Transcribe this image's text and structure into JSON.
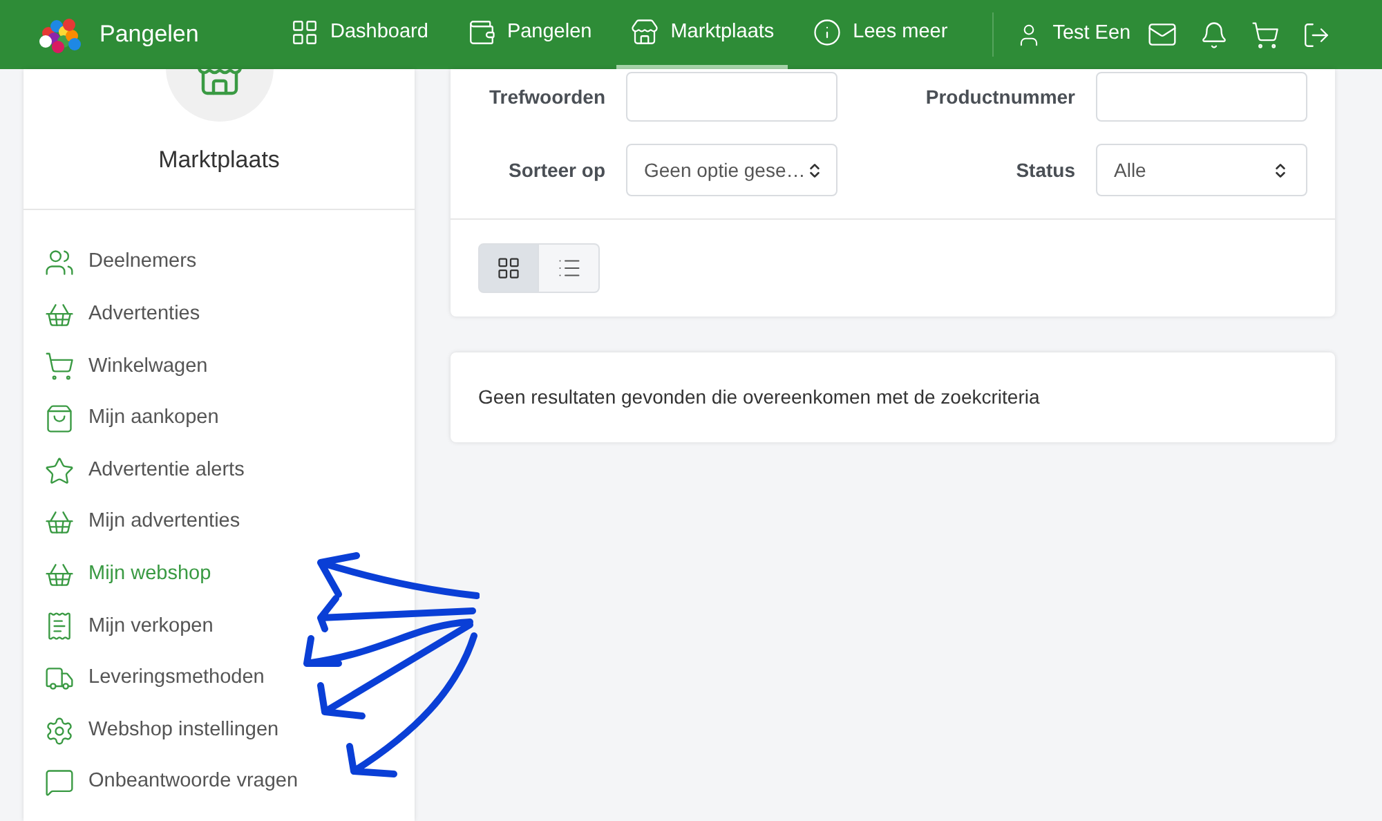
{
  "header": {
    "brand": "Pangelen",
    "nav": [
      {
        "label": "Dashboard",
        "selected": false
      },
      {
        "label": "Pangelen",
        "selected": false
      },
      {
        "label": "Marktplaats",
        "selected": true
      },
      {
        "label": "Lees meer",
        "selected": false
      }
    ],
    "user": "Test Een"
  },
  "sidebar": {
    "title": "Marktplaats",
    "items": [
      {
        "label": "Deelnemers",
        "selected": false
      },
      {
        "label": "Advertenties",
        "selected": false
      },
      {
        "label": "Winkelwagen",
        "selected": false
      },
      {
        "label": "Mijn aankopen",
        "selected": false
      },
      {
        "label": "Advertentie alerts",
        "selected": false
      },
      {
        "label": "Mijn advertenties",
        "selected": false
      },
      {
        "label": "Mijn webshop",
        "selected": true
      },
      {
        "label": "Mijn verkopen",
        "selected": false
      },
      {
        "label": "Leveringsmethoden",
        "selected": false
      },
      {
        "label": "Webshop instellingen",
        "selected": false
      },
      {
        "label": "Onbeantwoorde vragen",
        "selected": false
      }
    ]
  },
  "filters": {
    "keywords_label": "Trefwoorden",
    "product_number_label": "Productnummer",
    "sort_label": "Sorteer op",
    "sort_value": "Geen optie gese…",
    "status_label": "Status",
    "status_value": "Alle"
  },
  "view_toggle": [
    {
      "kind": "grid",
      "selected": true
    },
    {
      "kind": "list",
      "selected": false
    }
  ],
  "results": {
    "message": "Geen resultaten gevonden die overeenkomen met de zoekcriteria"
  }
}
